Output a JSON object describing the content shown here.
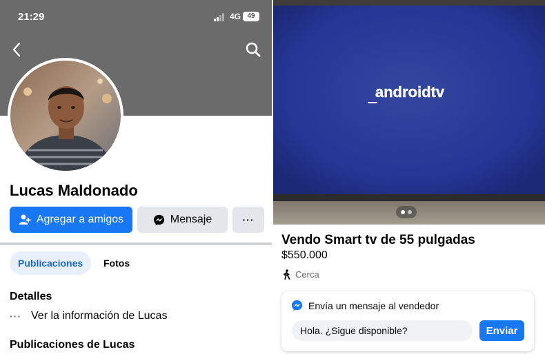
{
  "status_bar": {
    "time": "21:29",
    "network": "4G",
    "battery": "49"
  },
  "profile": {
    "name": "Lucas Maldonado",
    "add_friend_label": "Agregar a amigos",
    "message_label": "Mensaje",
    "more_label": "···",
    "tabs": [
      {
        "label": "Publicaciones",
        "active": true
      },
      {
        "label": "Fotos",
        "active": false
      }
    ],
    "details_title": "Detalles",
    "details_link_icon": "···",
    "details_link": "Ver la información de Lucas",
    "posts_title": "Publicaciones de Lucas"
  },
  "listing": {
    "photo_text": "androidtv",
    "title": "Vendo Smart tv de 55 pulgadas",
    "price": "$550.000",
    "location": "Cerca",
    "message_card": {
      "heading": "Envía un mensaje al vendedor",
      "input_value": "Hola. ¿Sigue disponible?",
      "send_label": "Enviar"
    }
  },
  "colors": {
    "brand_blue": "#1877f2",
    "secondary_button": "#e4e6eb",
    "active_tab_bg": "#e7f0fc",
    "active_tab_text": "#1b66c9",
    "muted_text": "#65676b",
    "cover_gray": "#6b6b6b",
    "tv_screen": "#26389a"
  },
  "icons": {
    "back": "chevron-left-icon",
    "search": "search-icon",
    "add_friend": "add-person-icon",
    "messenger": "messenger-icon",
    "location": "walking-person-icon",
    "pager": "carousel-dots-icon"
  }
}
